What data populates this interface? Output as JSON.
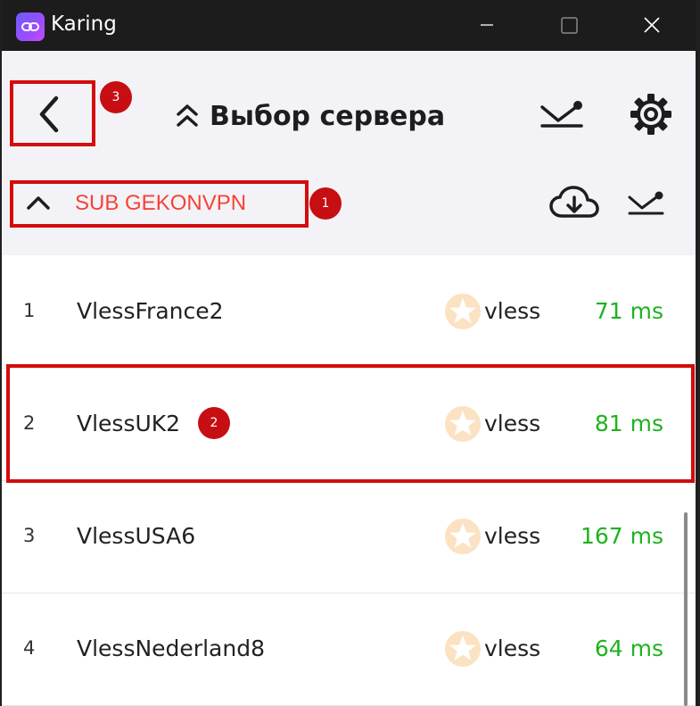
{
  "window": {
    "title": "Karing"
  },
  "header": {
    "title": "Выбор сервера"
  },
  "group": {
    "name": "SUB GEKONVPN"
  },
  "annotations": {
    "group": "1",
    "selected_row": "2",
    "back": "3"
  },
  "servers": [
    {
      "index": "1",
      "name": "VlessFrance2",
      "protocol": "vless",
      "latency": "71 ms"
    },
    {
      "index": "2",
      "name": "VlessUK2",
      "protocol": "vless",
      "latency": "81 ms"
    },
    {
      "index": "3",
      "name": "VlessUSA6",
      "protocol": "vless",
      "latency": "167 ms"
    },
    {
      "index": "4",
      "name": "VlessNederland8",
      "protocol": "vless",
      "latency": "64 ms"
    }
  ],
  "colors": {
    "accent_red": "#f44336",
    "annotation_red": "#d40c0c",
    "latency_green": "#1db31d",
    "header_bg": "#f3f2f7"
  },
  "icons": [
    "app-link-icon",
    "minimize-icon",
    "maximize-icon",
    "close-icon",
    "back-chevron-icon",
    "collapse-double-chevron-icon",
    "sort-icon",
    "gear-icon",
    "collapse-chevron-icon",
    "cloud-download-icon",
    "star-icon"
  ]
}
